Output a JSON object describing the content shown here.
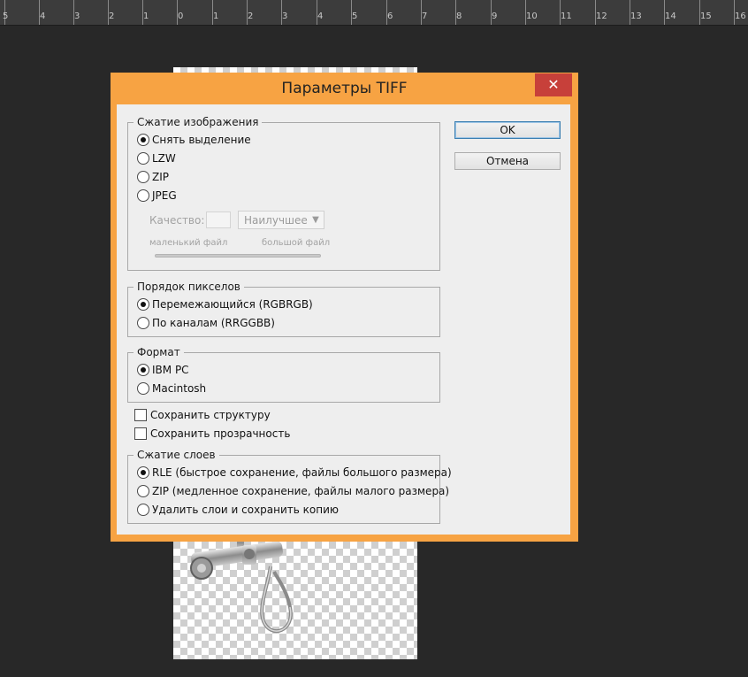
{
  "ruler": {
    "labels": [
      "5",
      "4",
      "3",
      "2",
      "1",
      "0",
      "1",
      "2",
      "3",
      "4",
      "5",
      "6",
      "7",
      "8",
      "9",
      "10",
      "11",
      "12",
      "13",
      "14",
      "15",
      "16"
    ]
  },
  "dialog": {
    "title": "Параметры TIFF",
    "close_label": "✕",
    "ok_label": "OK",
    "cancel_label": "Отмена",
    "image_compression": {
      "legend": "Сжатие изображения",
      "options": [
        "Снять выделение",
        "LZW",
        "ZIP",
        "JPEG"
      ],
      "selected": 0,
      "quality_label": "Качество:",
      "quality_value": "",
      "quality_preset": "Наилучшее",
      "small_file_label": "маленький файл",
      "large_file_label": "большой файл"
    },
    "pixel_order": {
      "legend": "Порядок пикселов",
      "options": [
        "Перемежающийся (RGBRGB)",
        "По каналам (RRGGBB)"
      ],
      "selected": 0
    },
    "byte_order": {
      "legend": "Формат",
      "options": [
        "IBM PC",
        "Macintosh"
      ],
      "selected": 0
    },
    "save_pyramid_label": "Сохранить структуру",
    "save_pyramid_checked": false,
    "save_transparency_label": "Сохранить прозрачность",
    "save_transparency_checked": false,
    "layer_compression": {
      "legend": "Сжатие слоев",
      "options": [
        "RLE (быстрое сохранение, файлы большого размера)",
        "ZIP (медленное сохранение, файлы малого размера)",
        "Удалить слои и сохранить копию"
      ],
      "selected": 0
    }
  }
}
